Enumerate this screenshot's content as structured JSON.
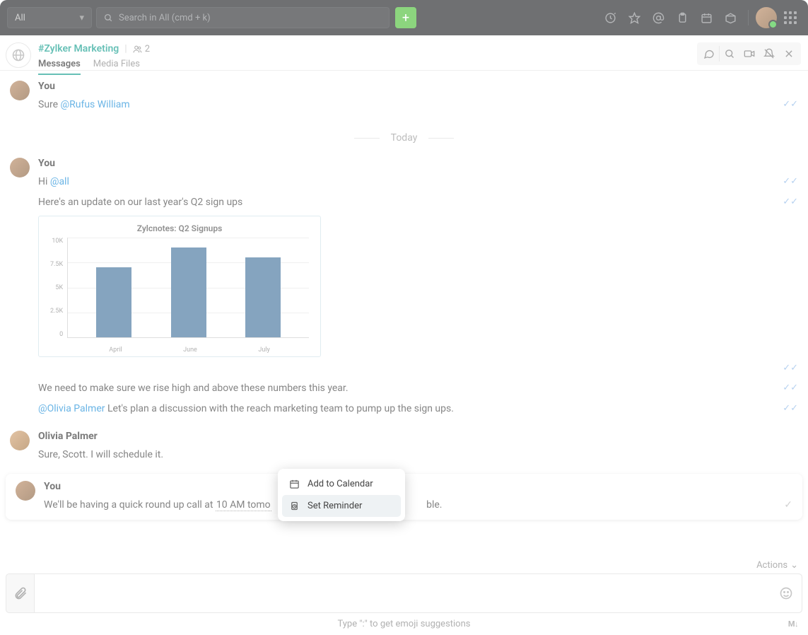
{
  "topbar": {
    "scope": "All",
    "search_placeholder": "Search in All (cmd + k)",
    "add_label": "+"
  },
  "channel": {
    "name": "#Zylker Marketing",
    "people_count": "2",
    "tabs": {
      "messages": "Messages",
      "media": "Media Files"
    }
  },
  "divider": {
    "today": "Today"
  },
  "messages": {
    "m1": {
      "sender": "You",
      "text_pre": "Sure ",
      "mention": "@Rufus William"
    },
    "m2": {
      "sender": "You",
      "l1_pre": "Hi ",
      "l1_mention": "@all",
      "l2": "Here's an update on our last year's Q2 sign ups",
      "l3": "We need to make sure we rise high and above these numbers this year.",
      "l4_mention": "@Olivia Palmer",
      "l4_rest": " Let's plan a discussion with the reach marketing team to pump up the sign ups."
    },
    "m3": {
      "sender": "Olivia Palmer",
      "text": "Sure, Scott. I will schedule it."
    },
    "m4": {
      "sender": "You",
      "pre": "We'll be having a quick round up call at  ",
      "time": "10 AM tomo",
      "post": "ble."
    }
  },
  "chart_data": {
    "type": "bar",
    "title": "Zylcnotes: Q2 Signups",
    "categories": [
      "April",
      "June",
      "July"
    ],
    "values": [
      7000,
      9000,
      8000
    ],
    "ylim": [
      0,
      10000
    ],
    "yticks": [
      "10K",
      "7.5K",
      "5K",
      "2.5K",
      "0"
    ]
  },
  "context_menu": {
    "add_calendar": "Add to Calendar",
    "set_reminder": "Set Reminder"
  },
  "footer": {
    "actions": "Actions",
    "hint": "Type \":\" to get emoji suggestions",
    "md": "M↓"
  }
}
